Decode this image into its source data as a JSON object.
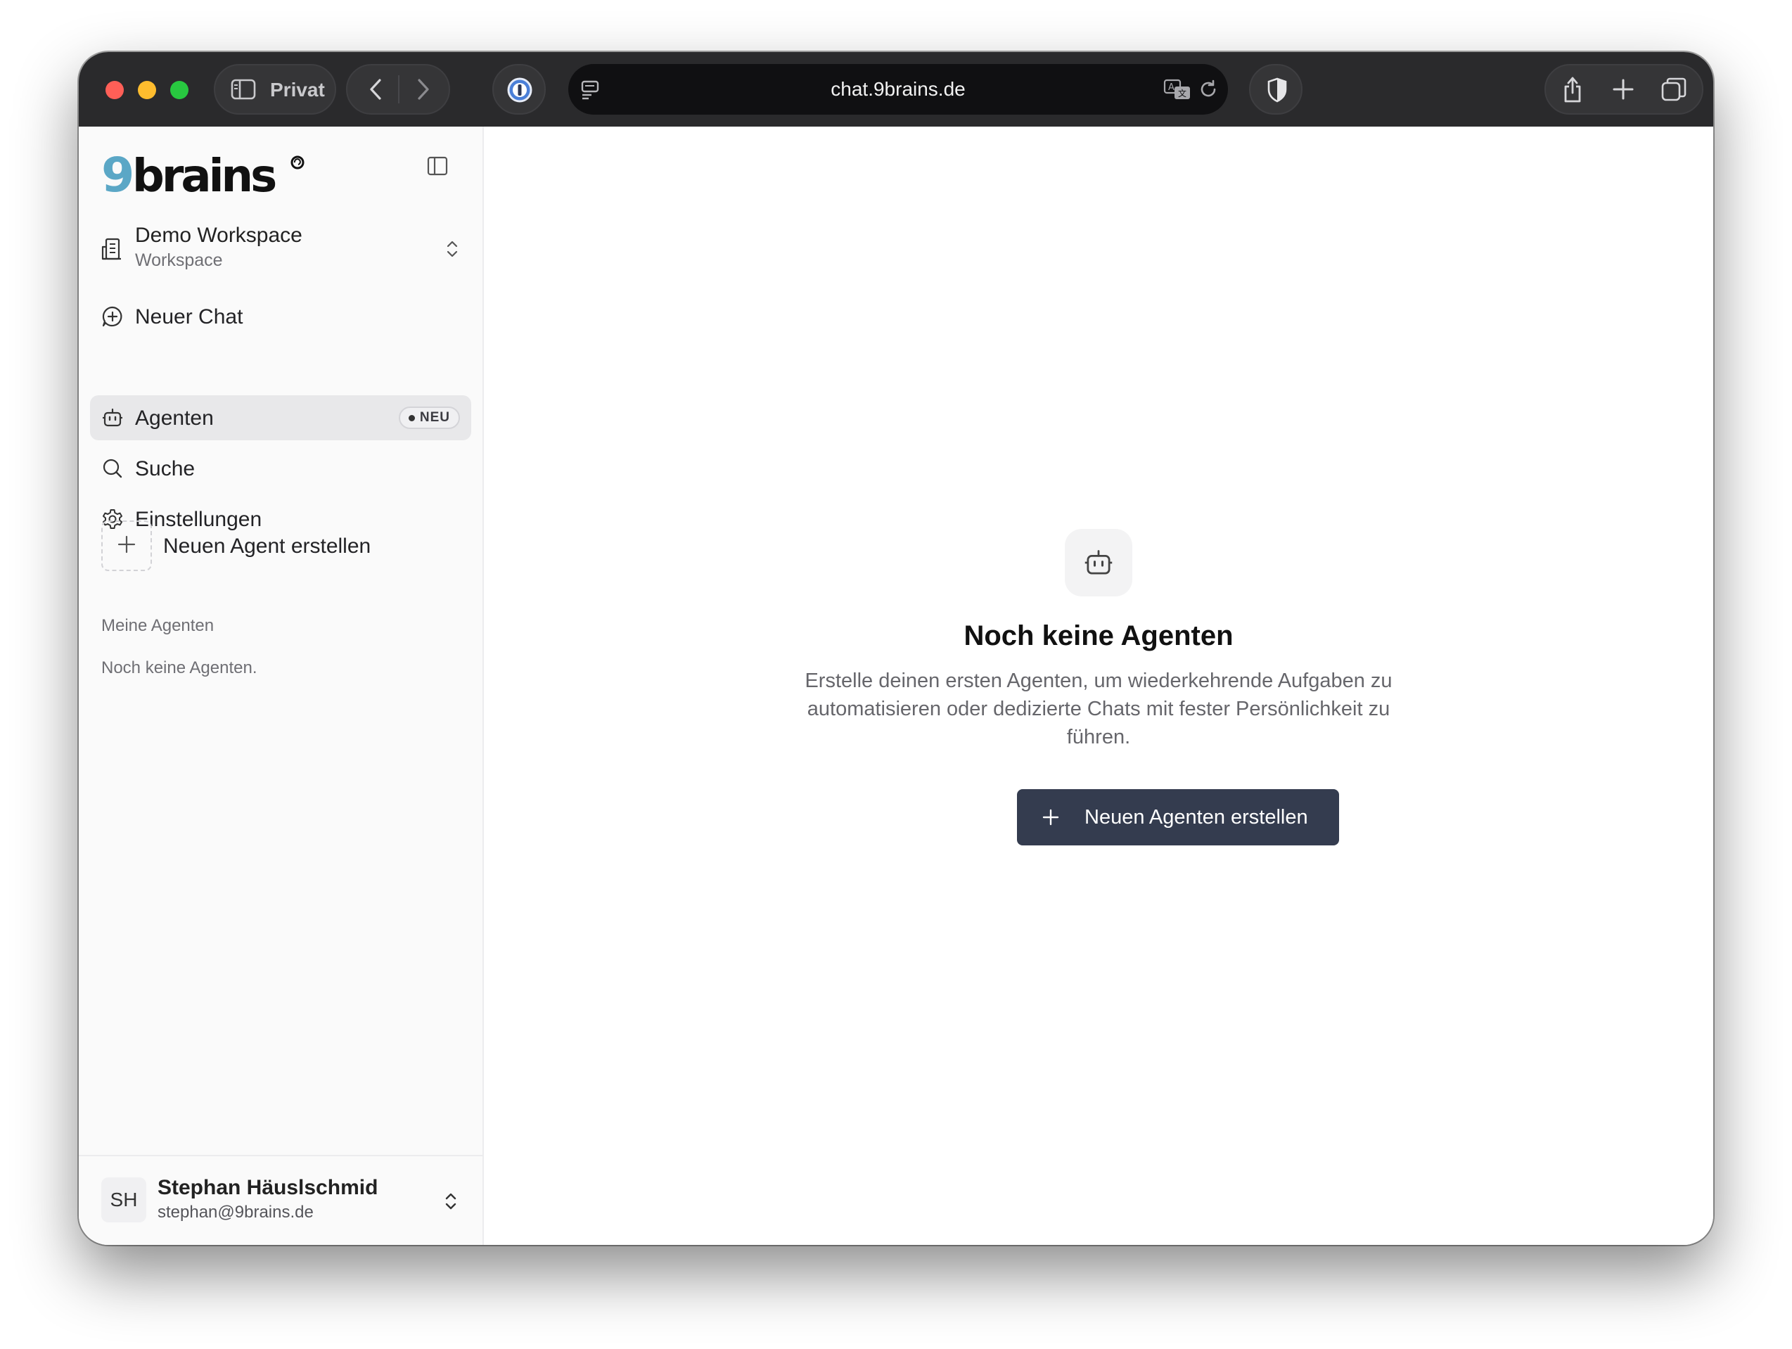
{
  "browser": {
    "mode_label": "Privat",
    "url": "chat.9brains.de"
  },
  "sidebar": {
    "logo_text": "9brains",
    "workspace": {
      "name": "Demo Workspace",
      "type": "Workspace"
    },
    "nav": [
      {
        "label": "Neuer Chat",
        "icon": "message-plus-icon"
      },
      {
        "label": "Agenten",
        "icon": "bot-icon",
        "badge": "NEU",
        "active": true
      },
      {
        "label": "Suche",
        "icon": "search-icon"
      },
      {
        "label": "Einstellungen",
        "icon": "gear-icon"
      }
    ],
    "new_agent_label": "Neuen Agent erstellen",
    "section_title": "Meine Agenten",
    "empty_note": "Noch keine Agenten.",
    "user": {
      "initials": "SH",
      "name": "Stephan Häuslschmid",
      "email": "stephan@9brains.de"
    }
  },
  "main": {
    "empty_title": "Noch keine Agenten",
    "empty_description": "Erstelle deinen ersten Agenten, um wiederkehrende Aufgaben zu automatisieren oder dedizierte Chats mit fester Persönlichkeit zu führen.",
    "cta_label": "Neuen Agenten erstellen"
  },
  "colors": {
    "accent_button": "#343c4f",
    "logo_nine": "#5ba7c6",
    "titlebar": "#2a2a2c"
  }
}
